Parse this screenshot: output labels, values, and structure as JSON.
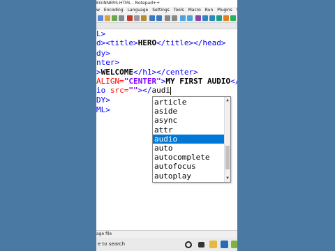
{
  "window": {
    "title": "EGINNERS.HTML - Notepad++"
  },
  "menu": [
    "w",
    "Encoding",
    "Language",
    "Settings",
    "Tools",
    "Macro",
    "Run",
    "Plugins",
    "Window"
  ],
  "editor_lines": [
    [
      {
        "t": "L>",
        "c": "tag"
      }
    ],
    [
      {
        "t": "d><title>",
        "c": "tag"
      },
      {
        "t": "HERO",
        "c": "txt"
      },
      {
        "t": "</title></head>",
        "c": "tag"
      }
    ],
    [
      {
        "t": "dy>",
        "c": "tag"
      }
    ],
    [
      {
        "t": "nter>",
        "c": "tag"
      }
    ],
    [
      {
        "t": ">",
        "c": "tag"
      },
      {
        "t": "WELCOME",
        "c": "txt"
      },
      {
        "t": "</h1></center>",
        "c": "tag"
      }
    ],
    [
      {
        "t": "ALIGN=",
        "c": "attr"
      },
      {
        "t": "\"CENTER\"",
        "c": "str"
      },
      {
        "t": ">",
        "c": "tag"
      },
      {
        "t": "MY FIRST AUDIO",
        "c": "txt"
      },
      {
        "t": "</",
        "c": "tag"
      }
    ],
    [
      {
        "t": "io ",
        "c": "tag"
      },
      {
        "t": "src=",
        "c": "attr"
      },
      {
        "t": "\"\"",
        "c": "str"
      },
      {
        "t": "></",
        "c": "tag"
      },
      {
        "t": "audi",
        "c": "plain"
      }
    ],
    [
      {
        "t": "DY>",
        "c": "tag"
      }
    ],
    [
      {
        "t": "ML>",
        "c": "tag"
      }
    ]
  ],
  "autocomplete": {
    "items": [
      "article",
      "aside",
      "async",
      "attr",
      "audio",
      "auto",
      "autocomplete",
      "autofocus",
      "autoplay"
    ],
    "selected_index": 4
  },
  "statusbar": {
    "text": "age file"
  },
  "taskbar": {
    "search_placeholder": "e to search"
  },
  "colors": {
    "tag": "#0000ff",
    "attribute": "#ff0000",
    "string": "#8000ff",
    "selection": "#0078d7"
  }
}
